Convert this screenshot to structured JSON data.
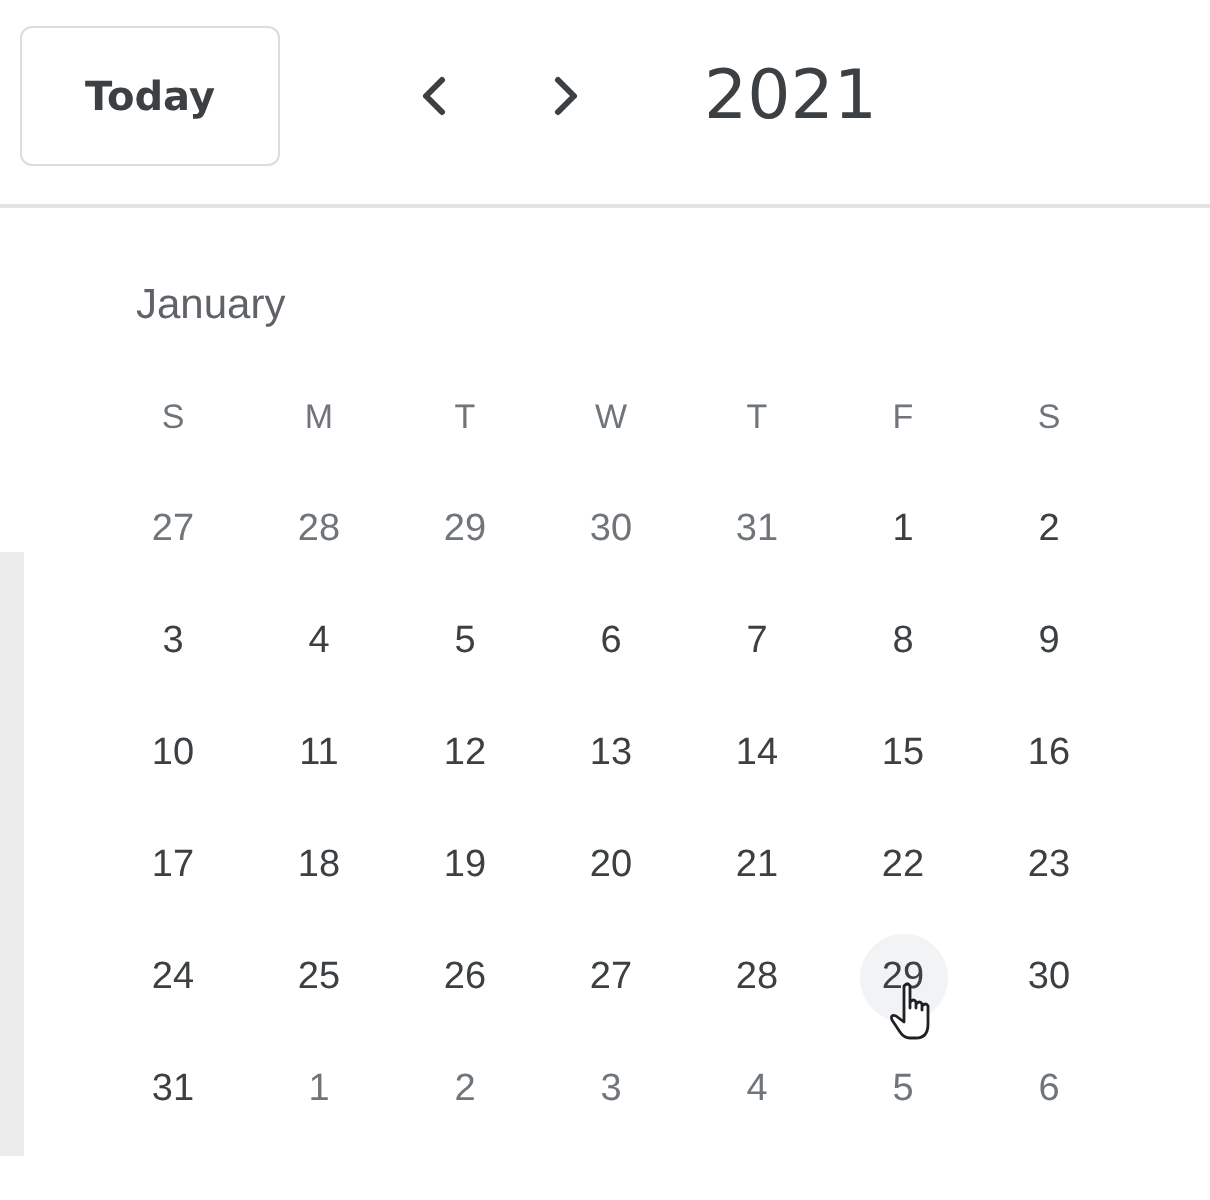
{
  "header": {
    "today_button": "Today",
    "year": "2021"
  },
  "month": {
    "title": "January",
    "weekdays": [
      "S",
      "M",
      "T",
      "W",
      "T",
      "F",
      "S"
    ],
    "weeks": [
      [
        {
          "label": "27",
          "muted": true,
          "hovered": false
        },
        {
          "label": "28",
          "muted": true,
          "hovered": false
        },
        {
          "label": "29",
          "muted": true,
          "hovered": false
        },
        {
          "label": "30",
          "muted": true,
          "hovered": false
        },
        {
          "label": "31",
          "muted": true,
          "hovered": false
        },
        {
          "label": "1",
          "muted": false,
          "hovered": false
        },
        {
          "label": "2",
          "muted": false,
          "hovered": false
        }
      ],
      [
        {
          "label": "3",
          "muted": false,
          "hovered": false
        },
        {
          "label": "4",
          "muted": false,
          "hovered": false
        },
        {
          "label": "5",
          "muted": false,
          "hovered": false
        },
        {
          "label": "6",
          "muted": false,
          "hovered": false
        },
        {
          "label": "7",
          "muted": false,
          "hovered": false
        },
        {
          "label": "8",
          "muted": false,
          "hovered": false
        },
        {
          "label": "9",
          "muted": false,
          "hovered": false
        }
      ],
      [
        {
          "label": "10",
          "muted": false,
          "hovered": false
        },
        {
          "label": "11",
          "muted": false,
          "hovered": false
        },
        {
          "label": "12",
          "muted": false,
          "hovered": false
        },
        {
          "label": "13",
          "muted": false,
          "hovered": false
        },
        {
          "label": "14",
          "muted": false,
          "hovered": false
        },
        {
          "label": "15",
          "muted": false,
          "hovered": false
        },
        {
          "label": "16",
          "muted": false,
          "hovered": false
        }
      ],
      [
        {
          "label": "17",
          "muted": false,
          "hovered": false
        },
        {
          "label": "18",
          "muted": false,
          "hovered": false
        },
        {
          "label": "19",
          "muted": false,
          "hovered": false
        },
        {
          "label": "20",
          "muted": false,
          "hovered": false
        },
        {
          "label": "21",
          "muted": false,
          "hovered": false
        },
        {
          "label": "22",
          "muted": false,
          "hovered": false
        },
        {
          "label": "23",
          "muted": false,
          "hovered": false
        }
      ],
      [
        {
          "label": "24",
          "muted": false,
          "hovered": false
        },
        {
          "label": "25",
          "muted": false,
          "hovered": false
        },
        {
          "label": "26",
          "muted": false,
          "hovered": false
        },
        {
          "label": "27",
          "muted": false,
          "hovered": false
        },
        {
          "label": "28",
          "muted": false,
          "hovered": false
        },
        {
          "label": "29",
          "muted": false,
          "hovered": true
        },
        {
          "label": "30",
          "muted": false,
          "hovered": false
        }
      ],
      [
        {
          "label": "31",
          "muted": false,
          "hovered": false
        },
        {
          "label": "1",
          "muted": true,
          "hovered": false
        },
        {
          "label": "2",
          "muted": true,
          "hovered": false
        },
        {
          "label": "3",
          "muted": true,
          "hovered": false
        },
        {
          "label": "4",
          "muted": true,
          "hovered": false
        },
        {
          "label": "5",
          "muted": true,
          "hovered": false
        },
        {
          "label": "6",
          "muted": true,
          "hovered": false
        }
      ]
    ]
  }
}
